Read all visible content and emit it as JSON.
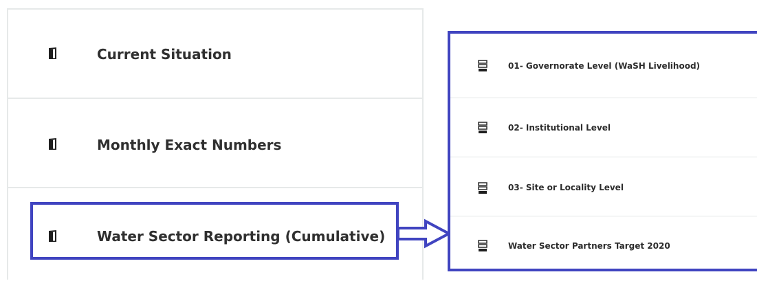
{
  "left_menu": {
    "items": [
      {
        "label": "Current Situation",
        "icon": "document-icon"
      },
      {
        "label": "Monthly Exact Numbers",
        "icon": "document-icon"
      },
      {
        "label": "Water Sector Reporting (Cumulative)",
        "icon": "document-icon"
      }
    ]
  },
  "right_menu": {
    "items": [
      {
        "label": "01- Governorate Level (WaSH Livelihood)",
        "icon": "report-icon"
      },
      {
        "label": "02- Institutional Level",
        "icon": "report-icon"
      },
      {
        "label": "03- Site or Locality Level",
        "icon": "report-icon"
      },
      {
        "label": "Water Sector Partners Target 2020",
        "icon": "report-icon"
      }
    ]
  },
  "colors": {
    "highlight": "#4044c0",
    "divider": "#e6e9e9",
    "text": "#2f2f2f"
  }
}
